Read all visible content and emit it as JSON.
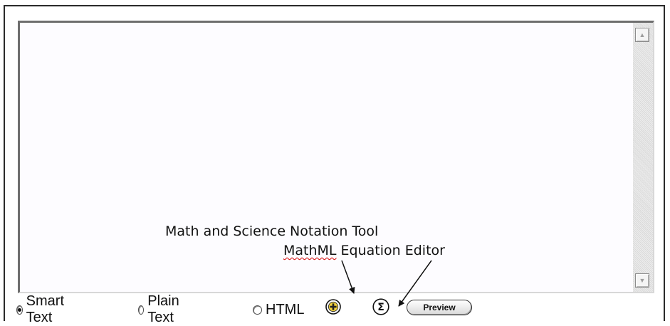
{
  "editor": {
    "text": "",
    "scroll_up_icon": "scroll-up-arrow",
    "scroll_down_icon": "scroll-down-arrow"
  },
  "annotations": {
    "math_tool": "Math and Science Notation Tool",
    "mathml_word": "MathML",
    "mathml_rest": " Equation Editor"
  },
  "format_options": [
    {
      "label": "Smart Text",
      "selected": true
    },
    {
      "label": "Plain Text",
      "selected": false
    },
    {
      "label": "HTML",
      "selected": false
    }
  ],
  "toolbar": {
    "math_notation_icon": "plus-circle-icon",
    "equation_icon": "sigma-icon",
    "preview_label": "Preview"
  },
  "colors": {
    "accent_plus": "#f4d23c",
    "squiggle": "#d40000"
  }
}
